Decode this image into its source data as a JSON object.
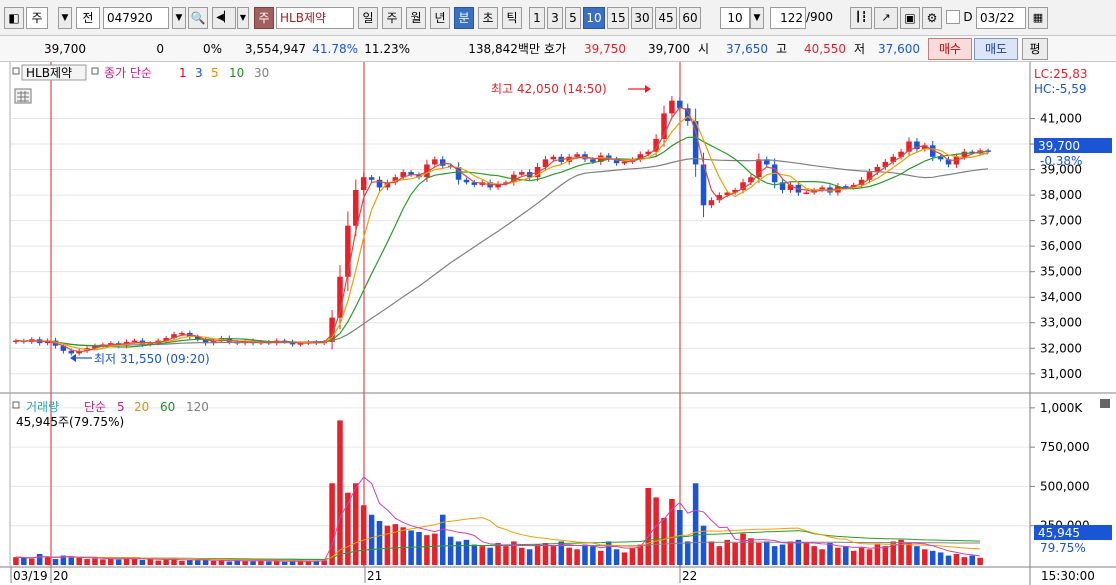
{
  "toolbar": {
    "type_label": "주",
    "type2_label": "전",
    "code": "047920",
    "stock_name": "HLB제약",
    "tags": [
      "주"
    ],
    "periods": [
      "일",
      "주",
      "월",
      "년",
      "분",
      "초",
      "틱"
    ],
    "active_period": "분",
    "intervals": [
      "1",
      "3",
      "5",
      "10",
      "15",
      "30",
      "45",
      "60"
    ],
    "active_interval": "10",
    "interval_value": "10",
    "count": "122",
    "count_total": "/900",
    "date_checkbox_label": "D",
    "date": "03/22"
  },
  "quote": {
    "price": "39,700",
    "change": "0",
    "change_pct": "0%",
    "volume": "3,554,947",
    "rate1": "41.78%",
    "rate2": "11.23%",
    "amount": "138,842백만",
    "ask_label": "호가",
    "ask": "39,750",
    "bid": "39,700",
    "open_label": "시",
    "open": "37,650",
    "high_label": "고",
    "high": "40,550",
    "low_label": "저",
    "low": "37,600",
    "buy_label": "매수",
    "sell_label": "매도",
    "eval_label": "평"
  },
  "price_panel": {
    "title": "HLB제약",
    "ma_label": "종가 단순",
    "ma_periods": [
      "1",
      "3",
      "5",
      "10",
      "30"
    ],
    "lc": "LC:25,83",
    "hc": "HC:-5,59",
    "last_price": "39,700",
    "last_change": "-0.38%",
    "max_annotation": "최고 42,050 (14:50)",
    "min_annotation": "최저 31,550 (09:20)"
  },
  "volume_panel": {
    "title": "거래량",
    "ma_label": "단순",
    "ma_periods": [
      "5",
      "20",
      "60",
      "120"
    ],
    "current_volume": "45,945주(79.75%)",
    "last_volume": "45,945",
    "last_pct": "79.75%"
  },
  "colors": {
    "up": "#e8202a",
    "down": "#1a55d6",
    "ma3": "#e04848",
    "ma5": "#f0a000",
    "ma10": "#2a9a2a",
    "ma30": "#808080",
    "grid": "#e6e6e6"
  },
  "time_axis": [
    "03/19",
    "20",
    "21",
    "22",
    "15:30:00"
  ],
  "chart_data": {
    "type": "candlestick",
    "price_axis": [
      "41,000",
      "40,000",
      "39,000",
      "38,000",
      "37,000",
      "36,000",
      "35,000",
      "34,000",
      "33,000",
      "32,000",
      "31,000"
    ],
    "volume_axis": [
      "1,000K",
      "750,000",
      "500,000",
      "250,000"
    ],
    "ylim": [
      30600,
      42900
    ],
    "volume_ylim": [
      0,
      1050000
    ],
    "closes": [
      32300,
      32250,
      32350,
      32200,
      32300,
      32100,
      31900,
      31800,
      31900,
      32000,
      32100,
      32150,
      32200,
      32100,
      32250,
      32300,
      32150,
      32200,
      32300,
      32400,
      32550,
      32600,
      32450,
      32350,
      32200,
      32300,
      32400,
      32250,
      32200,
      32300,
      32200,
      32250,
      32200,
      32300,
      32250,
      32150,
      32200,
      32250,
      32200,
      32250,
      33200,
      34800,
      36800,
      38200,
      38700,
      38600,
      38300,
      38500,
      38700,
      38900,
      38800,
      38700,
      39200,
      39400,
      39150,
      39100,
      38600,
      38500,
      38400,
      38500,
      38300,
      38450,
      38500,
      38800,
      38900,
      38700,
      39100,
      39400,
      39500,
      39300,
      39500,
      39600,
      39400,
      39300,
      39550,
      39400,
      39250,
      39300,
      39400,
      39600,
      39700,
      40200,
      41200,
      41700,
      41400,
      40900,
      39200,
      37600,
      37800,
      38000,
      38100,
      38200,
      38500,
      38700,
      39400,
      39200,
      38500,
      38200,
      38400,
      38100,
      38100,
      38200,
      38300,
      38100,
      38350,
      38300,
      38400,
      38600,
      38900,
      39100,
      39300,
      39500,
      39700,
      40100,
      39800,
      39950,
      39500,
      39400,
      39200,
      39500,
      39700,
      39650,
      39750,
      39700
    ],
    "volumes": [
      50000,
      46000,
      40000,
      70000,
      52000,
      38000,
      60000,
      50000,
      46000,
      38000,
      42000,
      36000,
      40000,
      34000,
      48000,
      40000,
      32000,
      38000,
      28000,
      36000,
      40000,
      26000,
      32000,
      30000,
      34000,
      26000,
      28000,
      22000,
      30000,
      26000,
      24000,
      28000,
      22000,
      26000,
      20000,
      24000,
      28000,
      22000,
      26000,
      30000,
      520000,
      920000,
      460000,
      520000,
      380000,
      320000,
      280000,
      250000,
      260000,
      240000,
      220000,
      210000,
      190000,
      200000,
      320000,
      180000,
      150000,
      160000,
      130000,
      120000,
      110000,
      140000,
      120000,
      150000,
      110000,
      100000,
      130000,
      140000,
      120000,
      150000,
      110000,
      100000,
      130000,
      120000,
      90000,
      150000,
      100000,
      80000,
      110000,
      130000,
      490000,
      430000,
      300000,
      420000,
      350000,
      150000,
      520000,
      250000,
      150000,
      120000,
      160000,
      140000,
      200000,
      170000,
      140000,
      150000,
      120000,
      130000,
      150000,
      160000,
      140000,
      120000,
      100000,
      140000,
      110000,
      120000,
      90000,
      110000,
      100000,
      130000,
      120000,
      150000,
      160000,
      140000,
      120000,
      100000,
      90000,
      80000,
      60000,
      70000,
      50000,
      60000,
      45945
    ]
  }
}
